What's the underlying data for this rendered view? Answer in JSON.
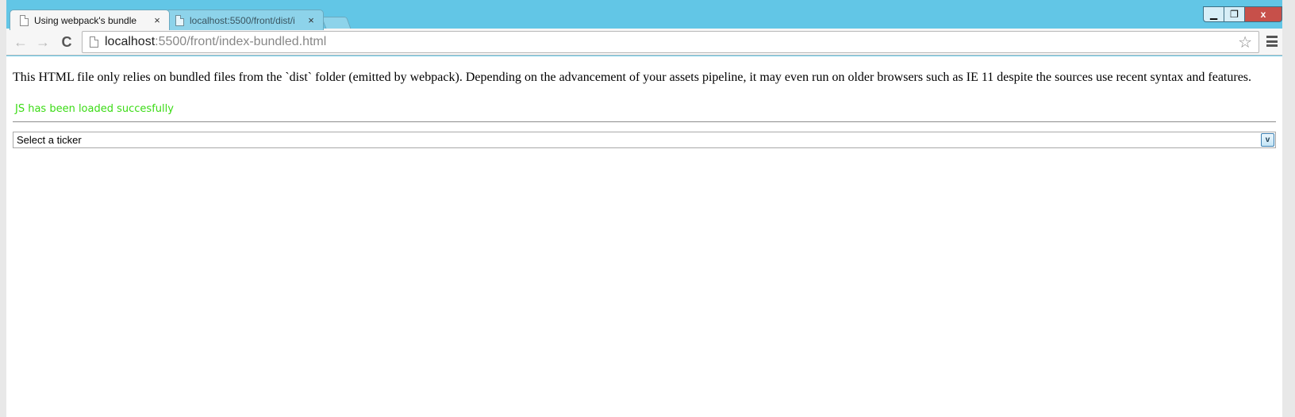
{
  "browser": {
    "tabs": [
      {
        "title": "Using webpack's bundle",
        "active": true,
        "close": "×"
      },
      {
        "title": "localhost:5500/front/dist/i",
        "active": false,
        "close": "×"
      }
    ],
    "window_controls": {
      "minimize": "▁",
      "maximize": "❐",
      "close": "x"
    },
    "nav": {
      "back": "←",
      "forward": "→",
      "reload": "C"
    },
    "address": {
      "host": "localhost",
      "rest": ":5500/front/index-bundled.html"
    },
    "bookmark_icon": "star-icon",
    "menu_icon": "hamburger-menu-icon"
  },
  "page": {
    "description": "This HTML file only relies on bundled files from the `dist` folder (emitted by webpack). Depending on the advancement of your assets pipeline, it may even run on older browsers such as IE 11 despite the sources use recent syntax and features.",
    "status": "JS has been loaded succesfully",
    "status_color": "#3adb14",
    "ticker_select": {
      "selected": "Select a ticker",
      "arrow": "v"
    }
  },
  "colors": {
    "titlebar": "#62c6e6",
    "close_button": "#c7504a"
  }
}
